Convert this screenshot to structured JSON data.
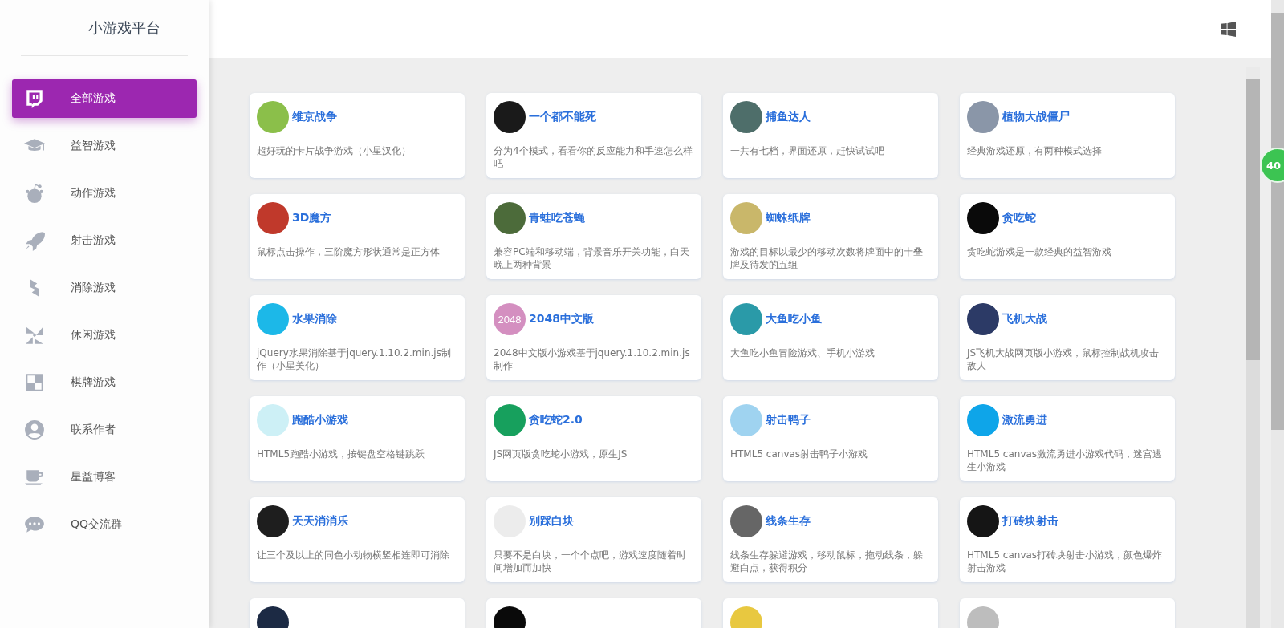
{
  "sidebar": {
    "logo": "小游戏平台",
    "items": [
      {
        "label": "全部游戏",
        "selected": true
      },
      {
        "label": "益智游戏",
        "selected": false
      },
      {
        "label": "动作游戏",
        "selected": false
      },
      {
        "label": "射击游戏",
        "selected": false
      },
      {
        "label": "消除游戏",
        "selected": false
      },
      {
        "label": "休闲游戏",
        "selected": false
      },
      {
        "label": "棋牌游戏",
        "selected": false
      },
      {
        "label": "联系作者",
        "selected": false
      },
      {
        "label": "星益博客",
        "selected": false
      },
      {
        "label": "QQ交流群",
        "selected": false
      }
    ]
  },
  "floating_badge": "40",
  "games": [
    {
      "kind": "card",
      "title": "维京战争",
      "desc": "超好玩的卡片战争游戏（小星汉化）",
      "color": "#8bbf4a"
    },
    {
      "kind": "card",
      "title": "一个都不能死",
      "desc": "分为4个模式，看看你的反应能力和手速怎么样吧",
      "color": "#1a1a1a"
    },
    {
      "kind": "card",
      "title": "捕鱼达人",
      "desc": "一共有七档，界面还原，赶快试试吧",
      "color": "#4e6e6a"
    },
    {
      "kind": "card",
      "title": "植物大战僵尸",
      "desc": "经典游戏还原，有两种模式选择",
      "color": "#8a96a8"
    },
    {
      "kind": "card",
      "title": "3D魔方",
      "desc": "鼠标点击操作，三阶魔方形状通常是正方体",
      "color": "#c0392b"
    },
    {
      "kind": "card",
      "title": "青蛙吃苍蝇",
      "desc": "兼容PC端和移动端，背景音乐开关功能，白天晚上两种背景",
      "color": "#4c6b3a"
    },
    {
      "kind": "card",
      "title": "蜘蛛纸牌",
      "desc": "游戏的目标以最少的移动次数将牌面中的十叠牌及待发的五组",
      "color": "#c9b76a"
    },
    {
      "kind": "card",
      "title": "贪吃蛇",
      "desc": "贪吃蛇游戏是一款经典的益智游戏",
      "color": "#0a0a0a"
    },
    {
      "kind": "card",
      "title": "水果消除",
      "desc": "jQuery水果消除基于jquery.1.10.2.min.js制作（小星美化）",
      "color": "#1cb8e8"
    },
    {
      "kind": "card",
      "title": "2048中文版",
      "desc": "2048中文版小游戏基于jquery.1.10.2.min.js制作",
      "color": "#d48fc0",
      "badge": "2048"
    },
    {
      "kind": "card",
      "title": "大鱼吃小鱼",
      "desc": "大鱼吃小鱼冒险游戏、手机小游戏",
      "color": "#2a9aa8"
    },
    {
      "kind": "card",
      "title": "飞机大战",
      "desc": "JS飞机大战网页版小游戏，鼠标控制战机攻击敌人",
      "color": "#2c3a66"
    },
    {
      "kind": "card",
      "title": "跑酷小游戏",
      "desc": "HTML5跑酷小游戏，按键盘空格键跳跃",
      "color": "#cdf0f6"
    },
    {
      "kind": "card",
      "title": "贪吃蛇2.0",
      "desc": "JS网页版贪吃蛇小游戏，原生JS",
      "color": "#17a05d"
    },
    {
      "kind": "card",
      "title": "射击鸭子",
      "desc": "HTML5 canvas射击鸭子小游戏",
      "color": "#9fd3f0"
    },
    {
      "kind": "card",
      "title": "激流勇进",
      "desc": "HTML5 canvas激流勇进小游戏代码，迷宫逃生小游戏",
      "color": "#0ea5e9"
    },
    {
      "kind": "card",
      "title": "天天消消乐",
      "desc": "让三个及以上的同色小动物横竖相连即可消除",
      "color": "#1e1e1e"
    },
    {
      "kind": "card",
      "title": "别踩白块",
      "desc": "只要不是白块，一个个点吧，游戏速度随着时间增加而加快",
      "color": "#ececec"
    },
    {
      "kind": "card",
      "title": "线条生存",
      "desc": "线条生存躲避游戏，移动鼠标，拖动线条，躲避白点，获得积分",
      "color": "#666666"
    },
    {
      "kind": "card",
      "title": "打砖块射击",
      "desc": "HTML5 canvas打砖块射击小游戏，颜色爆炸射击游戏",
      "color": "#151515"
    },
    {
      "kind": "partial",
      "color": "#1c2a44"
    },
    {
      "kind": "partial",
      "color": "#0a0a0a"
    },
    {
      "kind": "partial",
      "color": "#e8c840"
    },
    {
      "kind": "partial",
      "color": "#bdbdbd"
    }
  ]
}
